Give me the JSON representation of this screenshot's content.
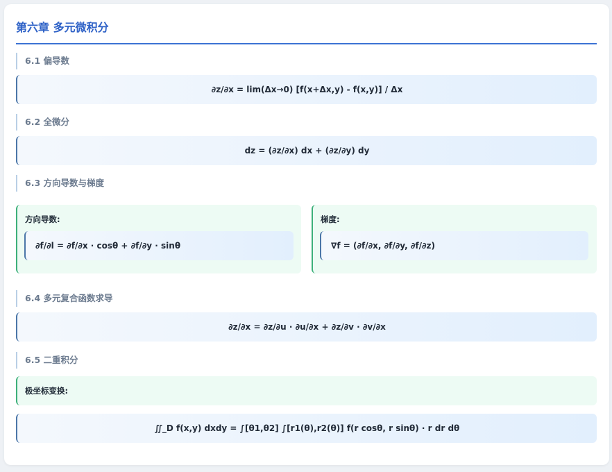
{
  "chapter": {
    "title": "第六章 多元微积分"
  },
  "sections": [
    {
      "heading": "6.1 偏导数",
      "formula": "∂z/∂x = lim(Δx→0) [f(x+Δx,y) - f(x,y)] / Δx"
    },
    {
      "heading": "6.2 全微分",
      "formula": "dz = (∂z/∂x) dx + (∂z/∂y) dy"
    },
    {
      "heading": "6.3 方向导数与梯度",
      "left": {
        "label": "方向导数:",
        "formula": "∂f/∂l = ∂f/∂x · cosθ + ∂f/∂y · sinθ"
      },
      "right": {
        "label": "梯度:",
        "formula": "∇f = (∂f/∂x, ∂f/∂y, ∂f/∂z)"
      }
    },
    {
      "heading": "6.4 多元复合函数求导",
      "formula": "∂z/∂x = ∂z/∂u · ∂u/∂x + ∂z/∂v · ∂v/∂x"
    },
    {
      "heading": "6.5 二重积分",
      "label": "极坐标变换:",
      "formula": "∬_D f(x,y) dxdy = ∫[θ1,θ2] ∫[r1(θ),r2(θ)] f(r cosθ, r sinθ) · r dr dθ"
    }
  ]
}
